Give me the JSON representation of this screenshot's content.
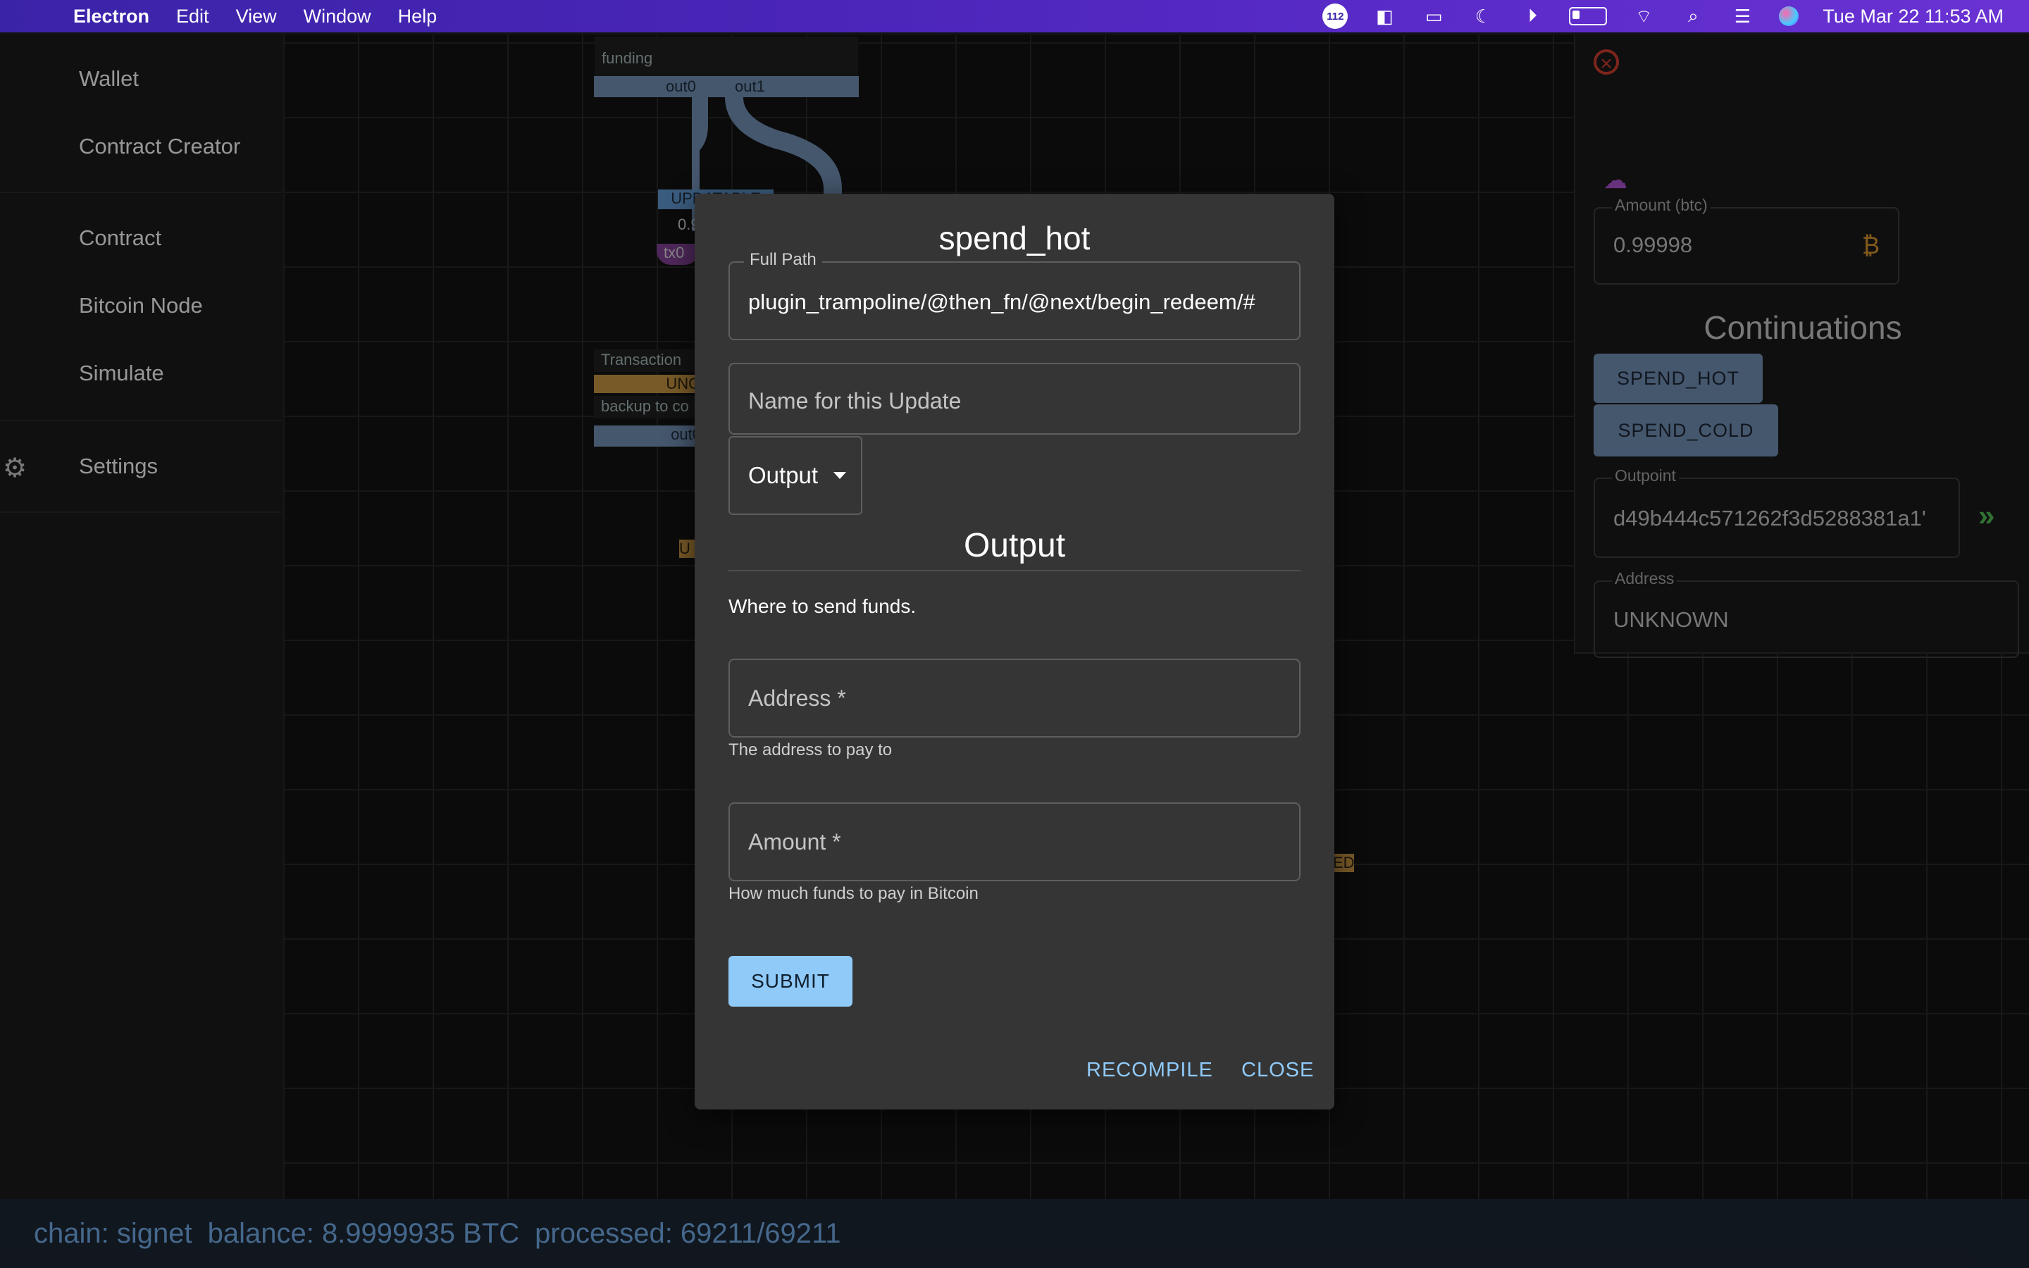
{
  "menubar": {
    "app": "Electron",
    "items": [
      "Edit",
      "View",
      "Window",
      "Help"
    ],
    "notification_count": "112",
    "datetime": "Tue Mar 22  11:53 AM"
  },
  "sidebar": {
    "items": [
      "Wallet",
      "Contract Creator",
      "Contract",
      "Bitcoin Node",
      "Simulate",
      "Settings"
    ]
  },
  "canvas": {
    "funding_label": "funding",
    "out0": "out0",
    "out1": "out1",
    "upd_label": "UPDATABLE",
    "amount_frag": "0.9",
    "tx_frag": "tx0",
    "transaction_label": "Transaction",
    "unc_frag": "UNC",
    "backup_frag": "backup to co",
    "out0b": "out0",
    "u_frag": "U",
    "ed_frag": "ED"
  },
  "status": {
    "chain": "chain: signet",
    "balance": "balance: 8.9999935 BTC",
    "processed": "processed: 69211/69211"
  },
  "right_panel": {
    "amount_label": "Amount (btc)",
    "amount_value": "0.99998",
    "currency_symbol": "₿",
    "continuations_title": "Continuations",
    "buttons": [
      "SPEND_HOT",
      "SPEND_COLD"
    ],
    "outpoint_label": "Outpoint",
    "outpoint_value": "d49b444c571262f3d5288381a1'",
    "address_label": "Address",
    "address_value": "UNKNOWN"
  },
  "modal": {
    "title": "spend_hot",
    "full_path_label": "Full Path",
    "full_path_value": "plugin_trampoline/@then_fn/@next/begin_redeem/#",
    "name_placeholder": "Name for this Update",
    "select_value": "Output",
    "section_title": "Output",
    "section_desc": "Where to send funds.",
    "address_placeholder": "Address *",
    "address_helper": "The address to pay to",
    "amount_placeholder": "Amount *",
    "amount_helper": "How much funds to pay in Bitcoin",
    "submit_label": "SUBMIT",
    "recompile_label": "RECOMPILE",
    "close_label": "CLOSE"
  },
  "colors": {
    "menubar_accent": "#4a25b8",
    "primary_button": "#90caf9",
    "node_bar": "#6b86a8",
    "status_text": "#6aa0d8"
  }
}
